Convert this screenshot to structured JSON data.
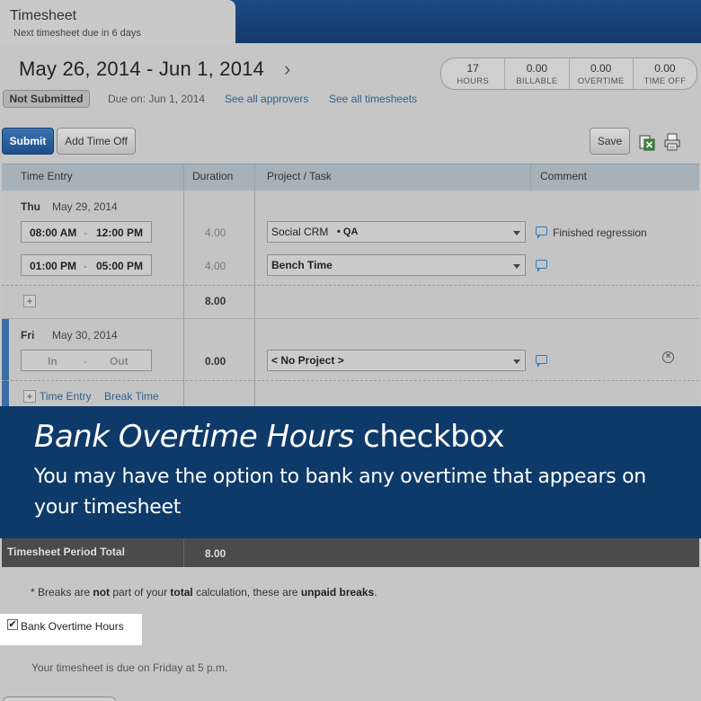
{
  "header": {
    "tab_title": "Timesheet",
    "tab_subtitle": "Next timesheet due in 6 days",
    "period": "May 26, 2014 - Jun 1, 2014",
    "period_chevron": "›"
  },
  "stats": [
    {
      "value": "17",
      "label": "HOURS"
    },
    {
      "value": "0.00",
      "label": "BILLABLE"
    },
    {
      "value": "0.00",
      "label": "OVERTIME"
    },
    {
      "value": "0.00",
      "label": "TIME OFF"
    }
  ],
  "status": {
    "badge": "Not Submitted",
    "due": "Due on: Jun 1, 2014",
    "see_approvers": "See all approvers",
    "see_timesheets": "See all timesheets"
  },
  "toolbar": {
    "submit_label": "Submit",
    "add_time_off_label": "Add Time Off",
    "save_label": "Save"
  },
  "table": {
    "columns": [
      "Time Entry",
      "Duration",
      "Project / Task",
      "Comment"
    ],
    "thu": {
      "day": "Thu",
      "date": "May 29, 2014",
      "entries": [
        {
          "start": "08:00 AM",
          "sep": "-",
          "end": "12:00 PM",
          "duration": "4.00",
          "project": "Social CRM",
          "task": "• QA",
          "comment": "Finished regression"
        },
        {
          "start": "01:00 PM",
          "sep": "-",
          "end": "05:00 PM",
          "duration": "4.00",
          "project": "Bench Time",
          "task": "",
          "comment": ""
        }
      ],
      "add": "+",
      "total": "8.00"
    },
    "fri": {
      "day": "Fri",
      "date": "May 30, 2014",
      "start_placeholder": "In",
      "sep": "-",
      "end_placeholder": "Out",
      "duration": "0.00",
      "project": "< No Project >",
      "remove": "×",
      "add": "+",
      "time_entry_link": "Time Entry",
      "break_time_link": "Break Time"
    }
  },
  "overlay": {
    "title_italic": "Bank Overtime Hours",
    "title_rest": " checkbox",
    "body": "You may have the option to bank any overtime that appears on your timesheet"
  },
  "footer": {
    "period_total_label": "Timesheet Period Total",
    "period_total_value": "8.00",
    "note_prefix": "* Breaks are ",
    "note_not": "not",
    "note_mid": " part of your ",
    "note_total": "total",
    "note_mid2": " calculation, these are ",
    "note_unpaid": "unpaid breaks",
    "note_end": ".",
    "bank_checked_mark": "✔",
    "bank_label": "Bank Overtime Hours",
    "due_note": "Your timesheet is due on Friday at 5 p.m."
  },
  "colors": {
    "accent_blue": "#1d4f8c",
    "overlay_blue": "#0e3a6a",
    "comment_icon": "#2f77b7"
  }
}
